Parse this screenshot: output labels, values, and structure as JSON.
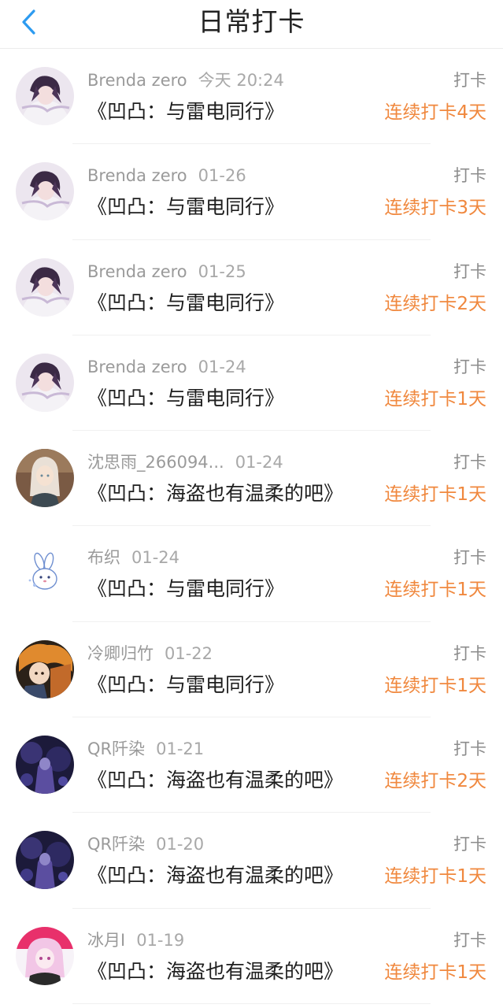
{
  "header": {
    "title": "日常打卡",
    "back_icon": "chevron-left-icon",
    "accent": "#2d9bf0"
  },
  "colors": {
    "streak": "#f0883e"
  },
  "items": [
    {
      "user": "Brenda zero",
      "time": "今天 20:24",
      "title": "《凹凸：与雷电同行》",
      "action": "打卡",
      "streak": "连续打卡4天",
      "avatar": "purple-anime-avatar"
    },
    {
      "user": "Brenda zero",
      "time": "01-26",
      "title": "《凹凸：与雷电同行》",
      "action": "打卡",
      "streak": "连续打卡3天",
      "avatar": "purple-anime-avatar"
    },
    {
      "user": "Brenda zero",
      "time": "01-25",
      "title": "《凹凸：与雷电同行》",
      "action": "打卡",
      "streak": "连续打卡2天",
      "avatar": "purple-anime-avatar"
    },
    {
      "user": "Brenda zero",
      "time": "01-24",
      "title": "《凹凸：与雷电同行》",
      "action": "打卡",
      "streak": "连续打卡1天",
      "avatar": "purple-anime-avatar"
    },
    {
      "user": "沈思雨_266094...",
      "time": "01-24",
      "title": "《凹凸：海盗也有温柔的吧》",
      "action": "打卡",
      "streak": "连续打卡1天",
      "avatar": "brown-anime-avatar"
    },
    {
      "user": "布织",
      "time": "01-24",
      "title": "《凹凸：与雷电同行》",
      "action": "打卡",
      "streak": "连续打卡1天",
      "avatar": "white-bunny-avatar"
    },
    {
      "user": "冷卿归竹",
      "time": "01-22",
      "title": "《凹凸：与雷电同行》",
      "action": "打卡",
      "streak": "连续打卡1天",
      "avatar": "orange-anime-avatar"
    },
    {
      "user": "QR阡染",
      "time": "01-21",
      "title": "《凹凸：海盗也有温柔的吧》",
      "action": "打卡",
      "streak": "连续打卡2天",
      "avatar": "dark-blue-anime-avatar"
    },
    {
      "user": "QR阡染",
      "time": "01-20",
      "title": "《凹凸：海盗也有温柔的吧》",
      "action": "打卡",
      "streak": "连续打卡1天",
      "avatar": "dark-blue-anime-avatar"
    },
    {
      "user": "冰月I",
      "time": "01-19",
      "title": "《凹凸：海盗也有温柔的吧》",
      "action": "打卡",
      "streak": "连续打卡1天",
      "avatar": "pink-anime-avatar"
    }
  ]
}
